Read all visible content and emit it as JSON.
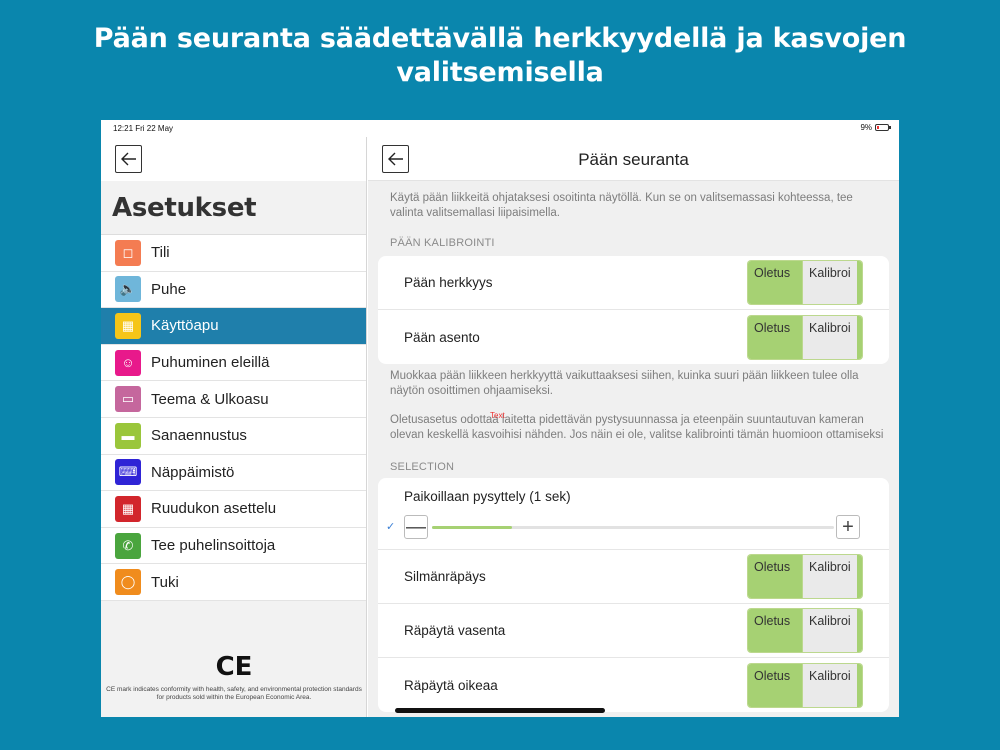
{
  "headline": "Pään seuranta säädettävällä herkkyydellä ja kasvojen valitsemisella",
  "status": {
    "time": "12:21  Fri 22 May",
    "battery": "9%"
  },
  "left": {
    "title": "Asetukset",
    "items": [
      {
        "label": "Tili",
        "icon": "person-icon",
        "color": "#f47c52"
      },
      {
        "label": "Puhe",
        "icon": "speaker-icon",
        "color": "#6fb6da"
      },
      {
        "label": "Käyttöapu",
        "icon": "grid-icon",
        "color": "#f5c518",
        "active": true
      },
      {
        "label": "Puhuminen eleillä",
        "icon": "face-gesture-icon",
        "color": "#e8198b"
      },
      {
        "label": "Teema & Ulkoasu",
        "icon": "window-icon",
        "color": "#c5679d"
      },
      {
        "label": "Sanaennustus",
        "icon": "word-prediction-icon",
        "color": "#9ac63b"
      },
      {
        "label": "Näppäimistö",
        "icon": "keyboard-icon",
        "color": "#2f24d6"
      },
      {
        "label": "Ruudukon asettelu",
        "icon": "grid-layout-icon",
        "color": "#d2262c"
      },
      {
        "label": "Tee puhelinsoittoja",
        "icon": "phone-icon",
        "color": "#4aa53e"
      },
      {
        "label": "Tuki",
        "icon": "lifebuoy-icon",
        "color": "#f08c1d"
      }
    ],
    "ce_mark": "CE",
    "ce_note": "CE mark indicates conformity with health, safety, and environmental protection standards for products sold within the European Economic Area."
  },
  "right": {
    "title": "Pään seuranta",
    "intro": "Käytä pään liikkeitä ohjataksesi osoitinta näytöllä. Kun se on valitsemassasi kohteessa, tee valinta valitsemallasi liipaisimella.",
    "section_calibration": "PÄÄN KALIBROINTI",
    "calibration_rows": [
      {
        "label": "Pään herkkyys",
        "on": "Oletus",
        "off": "Kalibroi"
      },
      {
        "label": "Pään asento",
        "on": "Oletus",
        "off": "Kalibroi"
      }
    ],
    "note1": "Muokkaa pään liikkeen herkkyyttä vaikuttaaksesi siihen, kuinka suuri pään liikkeen tulee olla näytön osoittimen ohjaamiseksi.",
    "note2": "Oletusasetus odottaa laitetta pidettävän pystysuunnassa ja eteenpäin suuntautuvan kameran olevan keskellä kasvoihisi nähden. Jos näin ei ole, valitse kalibrointi tämän huomioon ottamiseksi",
    "text_overlay": "Text",
    "section_selection": "SELECTION",
    "slider": {
      "label": "Paikoillaan pysyttely (1 sek)",
      "check": "✓",
      "minus": "—",
      "plus": "+",
      "level": 0.2
    },
    "selection_rows": [
      {
        "label": "Silmänräpäys",
        "on": "Oletus",
        "off": "Kalibroi"
      },
      {
        "label": "Räpäytä vasenta",
        "on": "Oletus",
        "off": "Kalibroi"
      },
      {
        "label": "Räpäytä oikeaa",
        "on": "Oletus",
        "off": "Kalibroi"
      }
    ]
  }
}
